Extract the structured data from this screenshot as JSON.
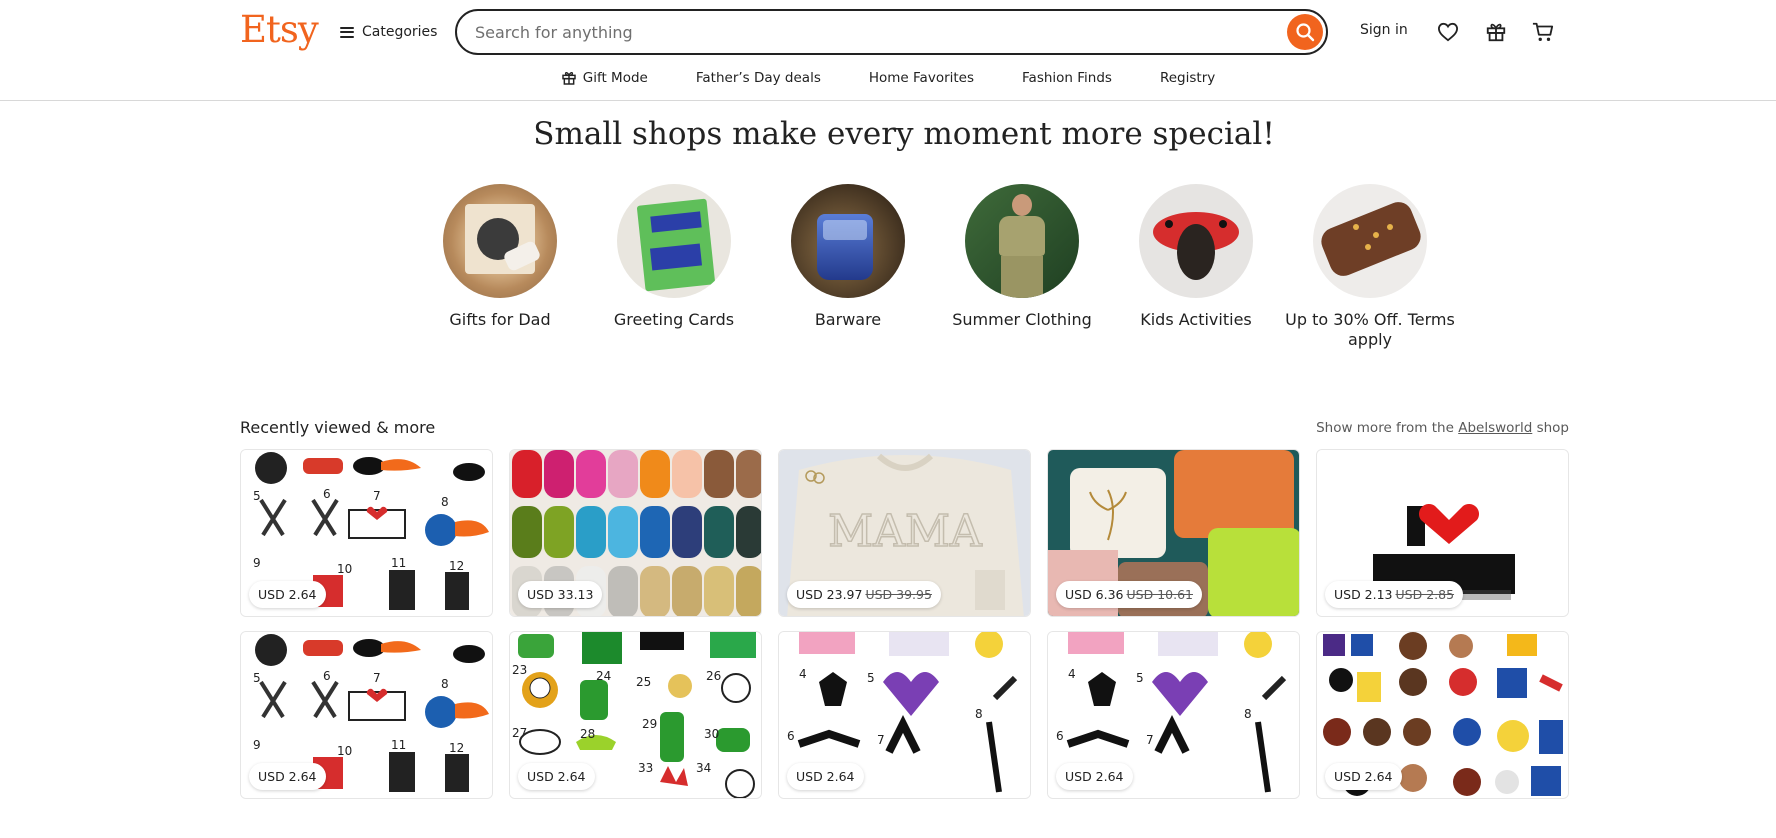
{
  "header": {
    "logo": "Etsy",
    "categories_label": "Categories",
    "search_placeholder": "Search for anything",
    "signin_label": "Sign in"
  },
  "subnav": [
    {
      "label": "Gift Mode",
      "icon": "gift-icon"
    },
    {
      "label": "Father’s Day deals"
    },
    {
      "label": "Home Favorites"
    },
    {
      "label": "Fashion Finds"
    },
    {
      "label": "Registry"
    }
  ],
  "hero": {
    "title": "Small shops make every moment more special!",
    "categories": [
      {
        "label": "Gifts for Dad"
      },
      {
        "label": "Greeting Cards"
      },
      {
        "label": "Barware"
      },
      {
        "label": "Summer Clothing"
      },
      {
        "label": "Kids Activities"
      },
      {
        "label": "Up to 30% Off. Terms apply"
      }
    ]
  },
  "recently_viewed": {
    "title": "Recently viewed & more",
    "more_prefix": "Show more from the",
    "shop_name": "Abelsworld",
    "more_suffix": "shop",
    "items": [
      {
        "price": "USD 2.64",
        "original": ""
      },
      {
        "price": "USD 33.13",
        "original": ""
      },
      {
        "price": "USD 23.97",
        "original": "USD 39.95"
      },
      {
        "price": "USD 6.36",
        "original": "USD 10.61"
      },
      {
        "price": "USD 2.13",
        "original": "USD 2.85"
      },
      {
        "price": "USD 2.64",
        "original": ""
      },
      {
        "price": "USD 2.64",
        "original": ""
      },
      {
        "price": "USD 2.64",
        "original": ""
      },
      {
        "price": "USD 2.64",
        "original": ""
      },
      {
        "price": "USD 2.64",
        "original": ""
      }
    ]
  },
  "colors": {
    "brand": "#f1641e",
    "text": "#222222"
  }
}
